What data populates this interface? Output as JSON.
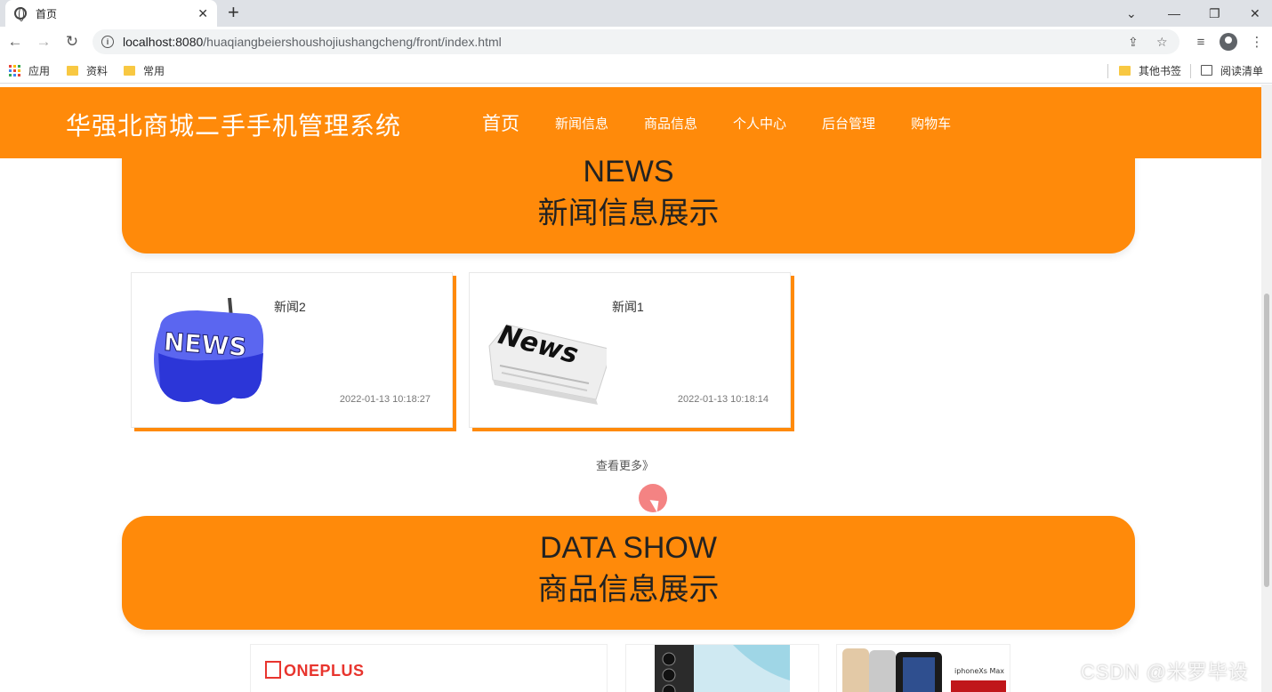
{
  "browser": {
    "tab_title": "首页",
    "tab_close": "✕",
    "new_tab": "+",
    "url_host": "localhost:8080",
    "url_path": "/huaqiangbeiershoushojiushangcheng/front/index.html",
    "bookmarks": [
      {
        "label": "应用",
        "icon": "apps-grid-icon"
      },
      {
        "label": "资料",
        "icon": "folder-icon"
      },
      {
        "label": "常用",
        "icon": "folder-icon"
      }
    ],
    "bookmarks_right": [
      {
        "label": "其他书签",
        "icon": "folder-icon"
      },
      {
        "label": "阅读清单",
        "icon": "reading-list-icon"
      }
    ]
  },
  "site": {
    "title": "华强北商城二手手机管理系统",
    "nav": [
      {
        "label": "首页",
        "active": true
      },
      {
        "label": "新闻信息"
      },
      {
        "label": "商品信息"
      },
      {
        "label": "个人中心"
      },
      {
        "label": "后台管理"
      },
      {
        "label": "购物车"
      }
    ]
  },
  "news_section": {
    "title_en": "NEWS",
    "title_zh": "新闻信息展示",
    "items": [
      {
        "title": "新闻2",
        "date": "2022-01-13 10:18:27",
        "image": "news-3d-blue-icon"
      },
      {
        "title": "新闻1",
        "date": "2022-01-13 10:18:14",
        "image": "news-paper-icon"
      }
    ],
    "more": "查看更多》"
  },
  "data_section": {
    "title_en": "DATA SHOW",
    "title_zh": "商品信息展示",
    "products": [
      {
        "brand": "ONEPLUS"
      },
      {
        "brand": ""
      },
      {
        "brand": ""
      }
    ]
  },
  "watermark": "CSDN @米罗毕设",
  "colors": {
    "accent": "#ff8a0a"
  }
}
